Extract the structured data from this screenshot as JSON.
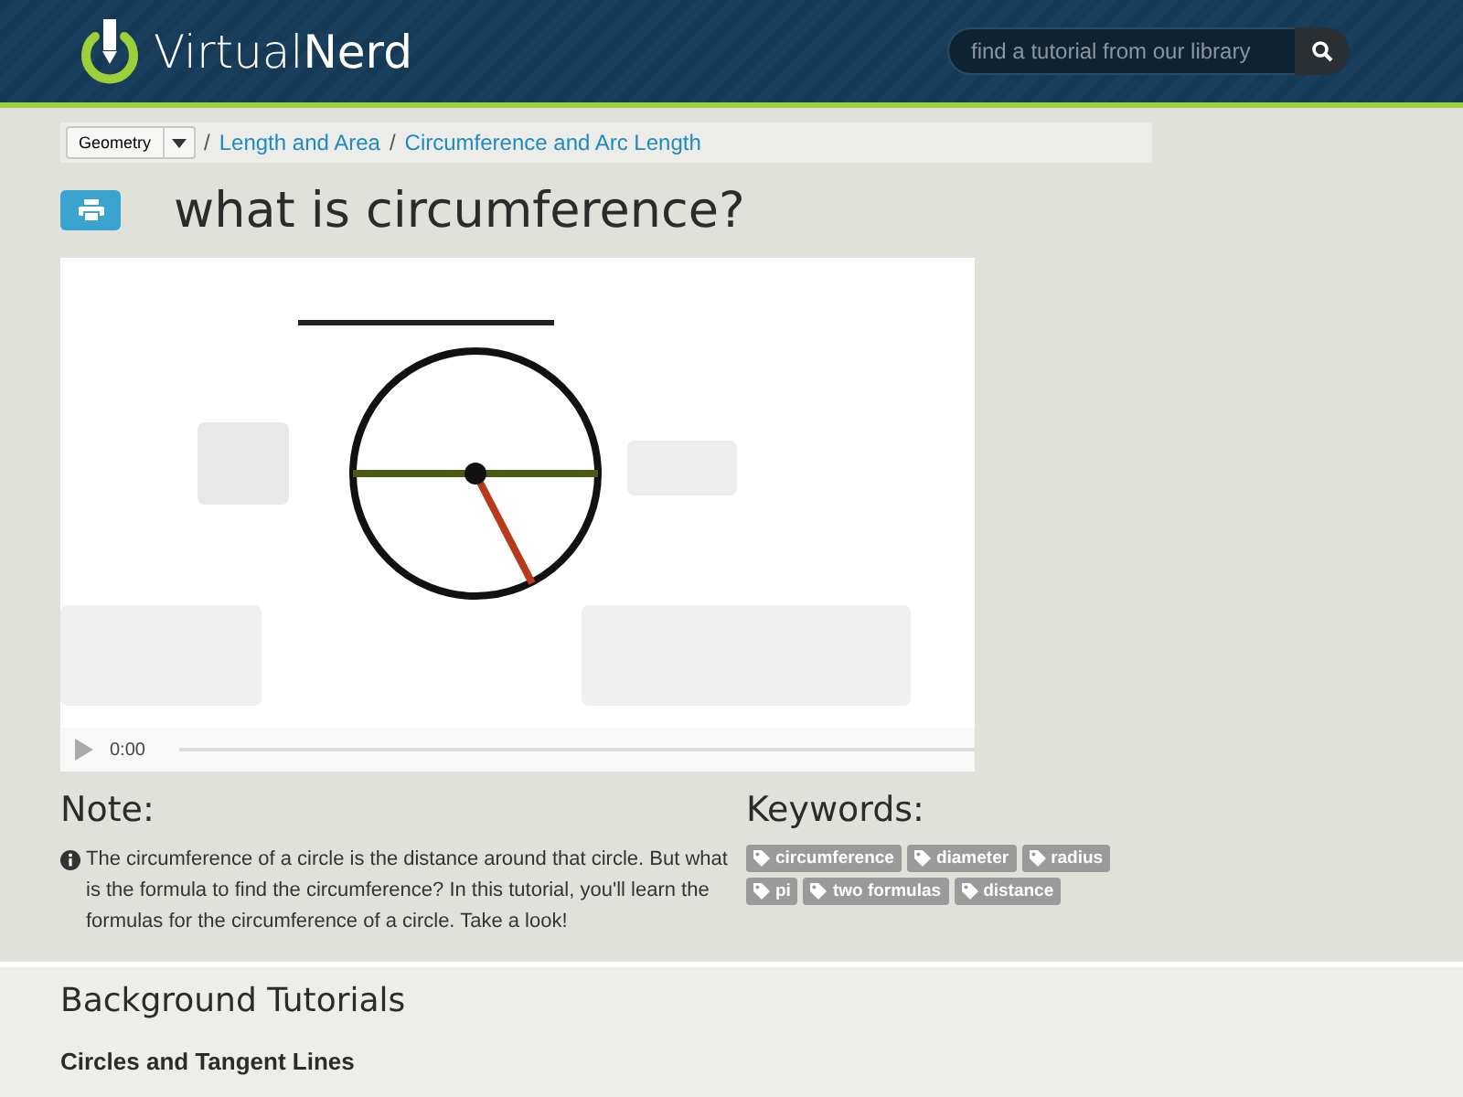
{
  "header": {
    "logo": "Virtual**Nerd**",
    "search": {
      "placeholder": "find a tutorial from our library"
    }
  },
  "breadcrumb": {
    "subject": "Geometry",
    "links": [
      {
        "separator": "/",
        "label": "Length and Area"
      },
      {
        "separator": "/",
        "label": "Circumference and Arc Length"
      }
    ]
  },
  "title": "what is circumference?",
  "video": {
    "kind": "picture",
    "time": "0:00"
  },
  "note": {
    "heading": "Note:",
    "text": "The circumference of a circle is the distance around that circle. But what is the formula to find the circumference? In this tutorial, you'll learn the formulas for the circumference of a circle. Take a look!"
  },
  "keywords": {
    "heading": "Keywords:",
    "tags": [
      "circumference",
      "diameter",
      "radius",
      "pi",
      "two formulas",
      "distance"
    ]
  },
  "background": {
    "heading": "Background Tutorials",
    "items": [
      "Circles and Tangent Lines"
    ]
  }
}
